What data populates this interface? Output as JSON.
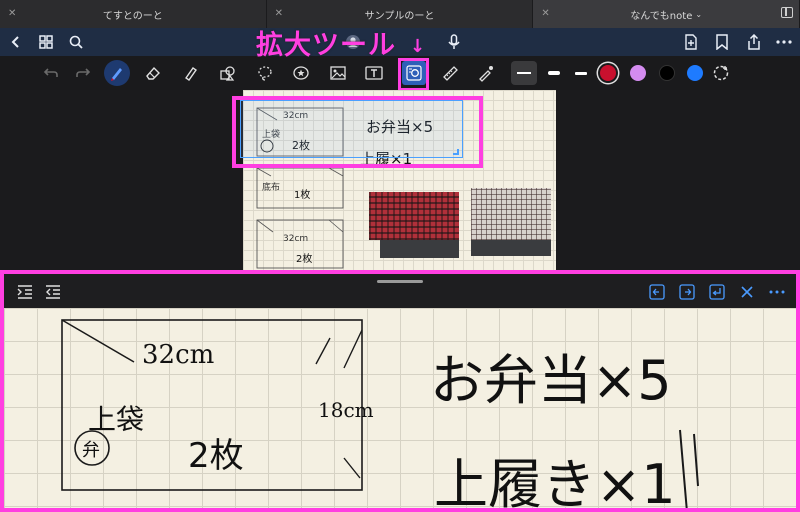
{
  "tabs": [
    {
      "label": "てすとのーと",
      "active": false
    },
    {
      "label": "サンプルのーと",
      "active": false
    },
    {
      "label": "なんでもnote",
      "active": true
    }
  ],
  "navbar": {
    "icons": [
      "back-icon",
      "grid-icon",
      "search-icon",
      "mic-icon",
      "add-page-icon",
      "bookmark-icon",
      "share-icon",
      "more-icon"
    ]
  },
  "toolbar": {
    "tools": [
      "undo-icon",
      "redo-icon",
      "pen-icon",
      "eraser-icon",
      "highlighter-icon",
      "shape-icon",
      "lasso-icon",
      "sticker-icon",
      "image-icon",
      "text-icon",
      "zoom-window-icon",
      "ruler-icon",
      "laser-pointer-icon"
    ],
    "colors": [
      "#c8102e",
      "#d48cf0",
      "#000000",
      "#1e7bff"
    ]
  },
  "annotation": {
    "label": "拡大ツール",
    "arrow": "↓",
    "highlight_color": "#ff3fe1"
  },
  "page": {
    "sketches": [
      {
        "dim": "32cm",
        "title": "上袋",
        "count": "2枚"
      },
      {
        "dim": "",
        "title": "底布",
        "count": "1枚"
      },
      {
        "dim": "32cm",
        "title": "",
        "count": "2枚"
      }
    ],
    "notes": [
      "お弁当×5",
      "上履×1"
    ]
  },
  "zoom_panel": {
    "sketch": {
      "width": "32cm",
      "height": "18cm",
      "label": "上袋",
      "count": "2枚"
    },
    "notes": [
      "お弁当×5",
      "上履き×1"
    ]
  }
}
